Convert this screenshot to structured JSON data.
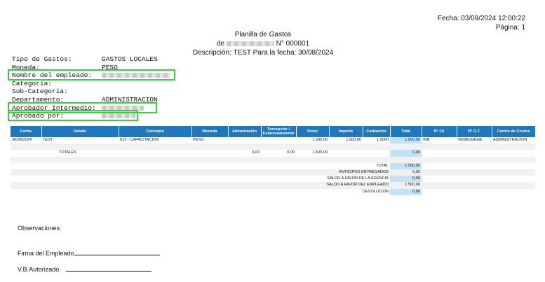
{
  "header": {
    "fecha_label": "Fecha:",
    "fecha_value": "03/09/2024",
    "hora": "12:00:22",
    "pagina_label": "Página:",
    "pagina_value": "1"
  },
  "title": {
    "line1": "Planilla de Gastos",
    "de": "de",
    "numero": "N° 000001",
    "line3": "Descripción: TEST Para la fecha: 30/08/2024"
  },
  "info": [
    {
      "label": "Tipo de Gastos:",
      "value": "GASTOS LOCALES",
      "redacted": false
    },
    {
      "label": "Moneda:",
      "value": "PESO",
      "redacted": false
    },
    {
      "label": "Nombre del empleado:",
      "value": "",
      "redacted": true
    },
    {
      "label": "Categoria:",
      "value": "",
      "redacted": false
    },
    {
      "label": "Sub-Categoria:",
      "value": "",
      "redacted": false
    },
    {
      "label": "Departamento:",
      "value": "ADMINISTRACION",
      "redacted": false
    },
    {
      "label": "Aprobador Intermedio:",
      "value": "",
      "redacted": true
    },
    {
      "label": "Aprobado por:",
      "value": "",
      "redacted": true
    }
  ],
  "table": {
    "columns": [
      "Fecha",
      "Detalle",
      "Concepto",
      "Moneda",
      "Alimentación",
      "Transporte / Estacionamiento",
      "Otros",
      "Importe",
      "Cotización",
      "Total",
      "N° Cli",
      "N° O.T.",
      "Centro de Costos"
    ],
    "rows": [
      [
        "30/08/2024",
        "TEST",
        "012 - CAPACITACION",
        "PESO",
        "",
        "",
        "1.500,00",
        "1.500,00",
        "1,0000",
        "1.500,00",
        "INB",
        "000861GENE",
        "ADMINISTRACION"
      ]
    ],
    "totales": {
      "label": "TOTALES",
      "alimentacion": "0,00",
      "transporte": "0,00",
      "otros": "1.500,00",
      "total": "0,00"
    },
    "summary": [
      {
        "label": "TOTAL",
        "value": "1.500,00"
      },
      {
        "label": "ANTICIPOS ENTREGADOS",
        "value": "0,00"
      },
      {
        "label": "SALDO A FAVOR DE LA AGENCIA",
        "value": "0,00"
      },
      {
        "label": "SALDO A FAVOR DEL EMPLEADO",
        "value": "1.500,00"
      },
      {
        "label": "DEVOLUCION",
        "value": "0,00"
      }
    ]
  },
  "footer": {
    "observaciones": "Observaciones:",
    "firma": "Firma del Empleado",
    "vb": "V.B.Autorizado"
  },
  "colors": {
    "table_header": "#1f77bd",
    "total_column": "#bfe3f7",
    "highlight": "#36d23a"
  }
}
